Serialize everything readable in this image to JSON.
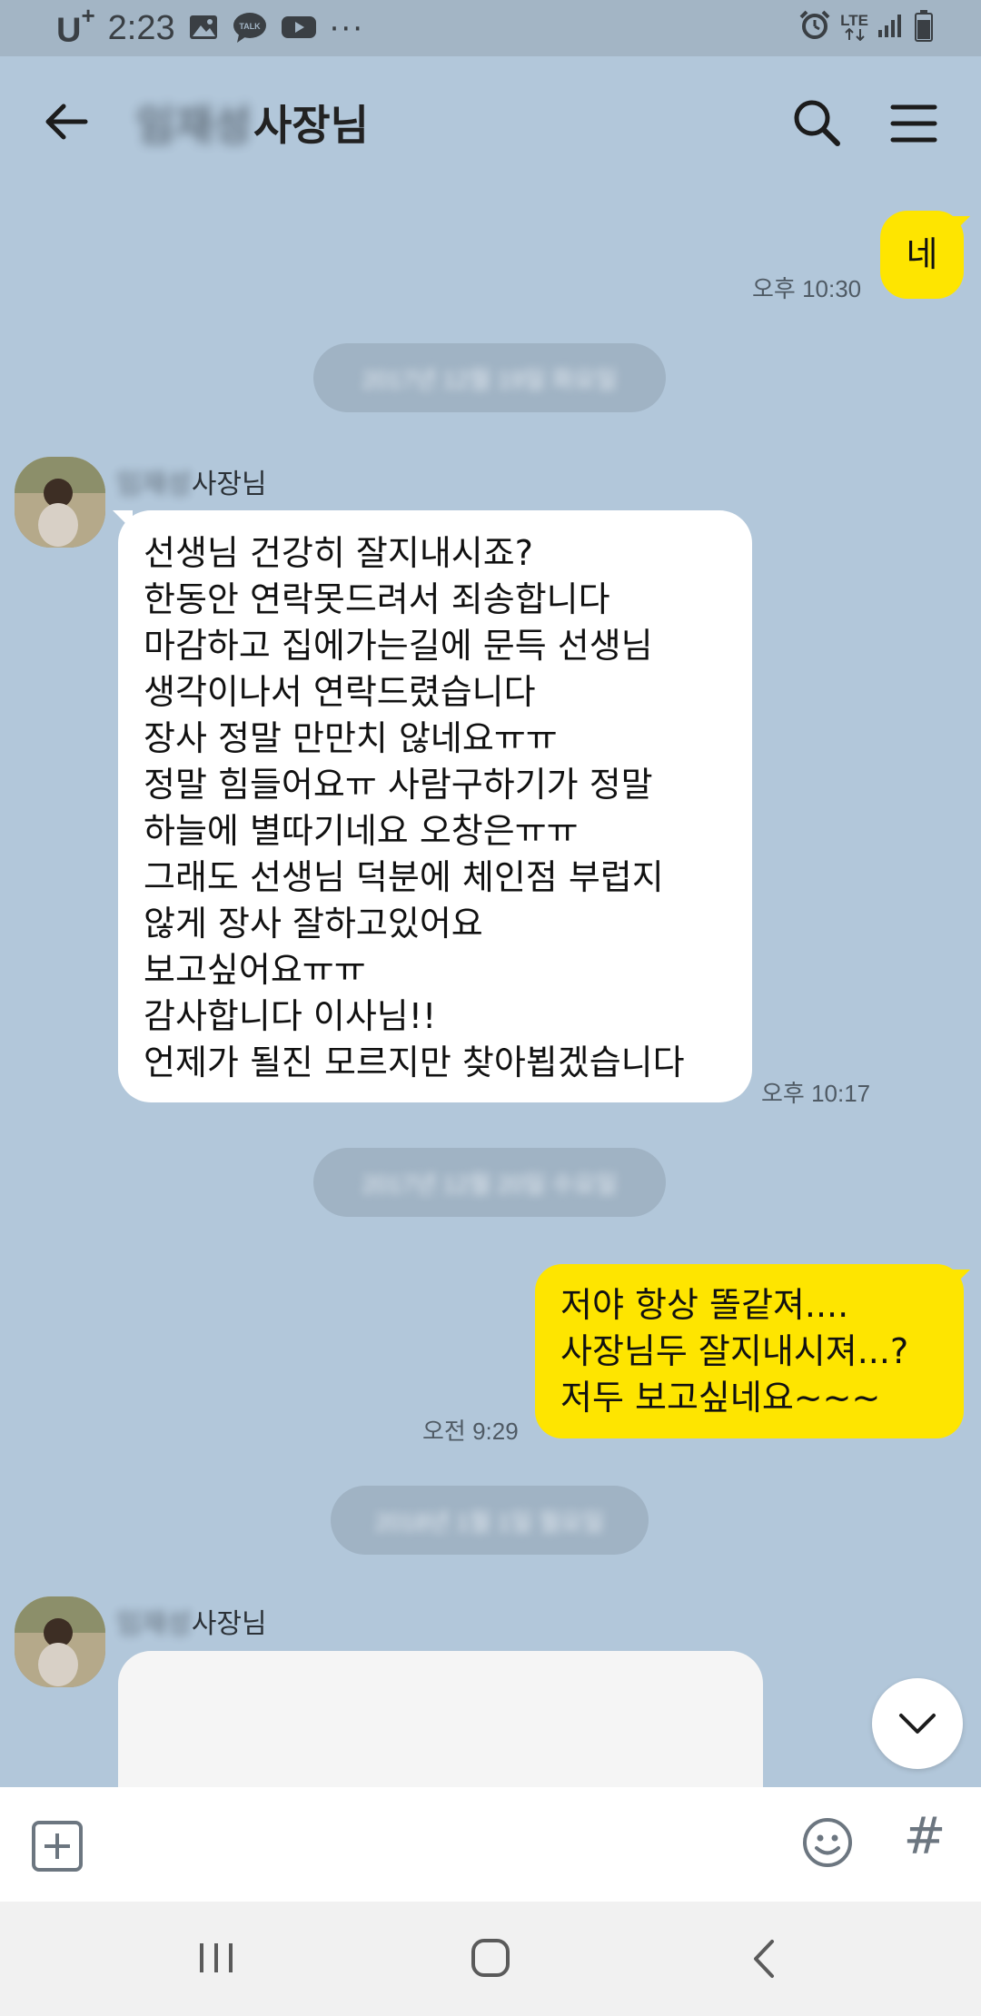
{
  "status_bar": {
    "carrier": "U",
    "carrier_plus": "+",
    "time": "2:23",
    "notification_icons": [
      "image-icon",
      "talk-icon",
      "youtube-icon",
      "more-icon"
    ],
    "talk_label": "TALK",
    "more": "···",
    "network": "LTE",
    "right_icons": [
      "alarm-icon",
      "lte-icon",
      "signal-icon",
      "battery-icon"
    ]
  },
  "header": {
    "title_hidden": "임재성",
    "title": "사장님",
    "back_icon": "arrow-left-icon",
    "search_icon": "search-icon",
    "menu_icon": "menu-icon"
  },
  "messages": [
    {
      "type": "me",
      "text": "네",
      "time": "오후 10:30"
    },
    {
      "type": "date",
      "text": "2017년 12월 19일 화요일"
    },
    {
      "type": "other",
      "sender_hidden": "임재성",
      "sender": "사장님",
      "text": "선생님 건강히 잘지내시죠?\n한동안 연락못드려서 죄송합니다\n마감하고 집에가는길에 문득 선생님\n생각이나서 연락드렸습니다\n장사 정말 만만치 않네요ㅠㅠ\n정말 힘들어요ㅠ 사람구하기가 정말\n하늘에 별따기네요 오창은ㅠㅠ\n그래도 선생님 덕분에 체인점 부럽지\n않게 장사 잘하고있어요\n보고싶어요ㅠㅠ\n감사합니다 이사님!!\n언제가 될진 모르지만 찾아뵙겠습니다",
      "time": "오후 10:17"
    },
    {
      "type": "date",
      "text": "2017년 12월 20일 수요일"
    },
    {
      "type": "me",
      "text": "저야 항상 똘같져....\n사장님두 잘지내시져...?\n저두 보고싶네요~~~",
      "time": "오전 9:29"
    },
    {
      "type": "date",
      "text": "2018년 1월 1일 월요일"
    },
    {
      "type": "other",
      "sender_hidden": "임재성",
      "sender": "사장님",
      "text": ""
    }
  ],
  "scroll_down_icon": "chevron-down-icon",
  "input_bar": {
    "attach_icon": "plus-square-icon",
    "emoji_icon": "emoji-icon",
    "hashtag": "#"
  },
  "nav_bar": {
    "icons": [
      "recent-apps-icon",
      "home-icon",
      "back-icon"
    ]
  },
  "colors": {
    "chat_background": "#b2c7da",
    "my_bubble": "#fee500",
    "other_bubble": "#ffffff",
    "date_pill": "#a0b3c4"
  }
}
